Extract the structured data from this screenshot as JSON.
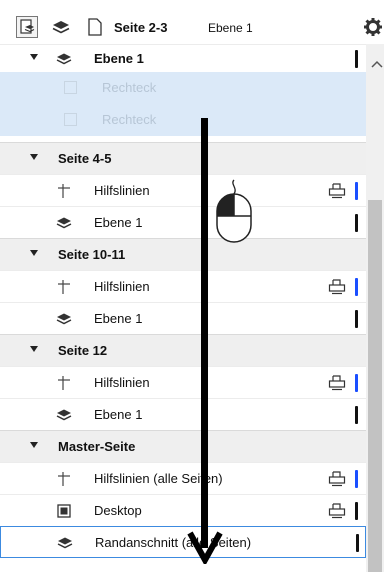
{
  "toolbar": {
    "title": "Seite 2-3",
    "layer": "Ebene 1",
    "icons": [
      "page-layers-icon",
      "layers-icon",
      "page-icon",
      "gear-icon"
    ]
  },
  "rows": [
    {
      "type": "item-layer",
      "label": "Ebene 1",
      "bold": true,
      "icon": "layers-icon",
      "bar": "black"
    },
    {
      "type": "selected",
      "label": "Rechteck"
    },
    {
      "type": "selected",
      "label": "Rechteck"
    },
    {
      "type": "header",
      "label": "Seite 4-5"
    },
    {
      "type": "item",
      "label": "Hilfslinien",
      "icon": "guides-icon",
      "print": true,
      "bar": "blue"
    },
    {
      "type": "item",
      "label": "Ebene 1",
      "icon": "layers-icon",
      "bar": "black"
    },
    {
      "type": "header",
      "label": "Seite 10-11"
    },
    {
      "type": "item",
      "label": "Hilfslinien",
      "icon": "guides-icon",
      "print": true,
      "bar": "blue"
    },
    {
      "type": "item",
      "label": "Ebene 1",
      "icon": "layers-icon",
      "bar": "black"
    },
    {
      "type": "header",
      "label": "Seite 12"
    },
    {
      "type": "item",
      "label": "Hilfslinien",
      "icon": "guides-icon",
      "print": true,
      "bar": "blue"
    },
    {
      "type": "item",
      "label": "Ebene 1",
      "icon": "layers-icon",
      "bar": "black"
    },
    {
      "type": "header",
      "label": "Master-Seite"
    },
    {
      "type": "item",
      "label": "Hilfslinien (alle Seiten)",
      "icon": "guides-icon",
      "print": true,
      "bar": "blue"
    },
    {
      "type": "item",
      "label": "Desktop",
      "icon": "desktop-icon",
      "print": true,
      "bar": "black"
    },
    {
      "type": "item",
      "label": "Randanschnitt (alle Seiten)",
      "icon": "layers-icon",
      "bar": "black",
      "focus": true
    }
  ],
  "colors": {
    "selected": "#dbe9f8",
    "header": "#efefef",
    "focus": "#3c8ae0",
    "blue_bar": "#1a4fff"
  }
}
